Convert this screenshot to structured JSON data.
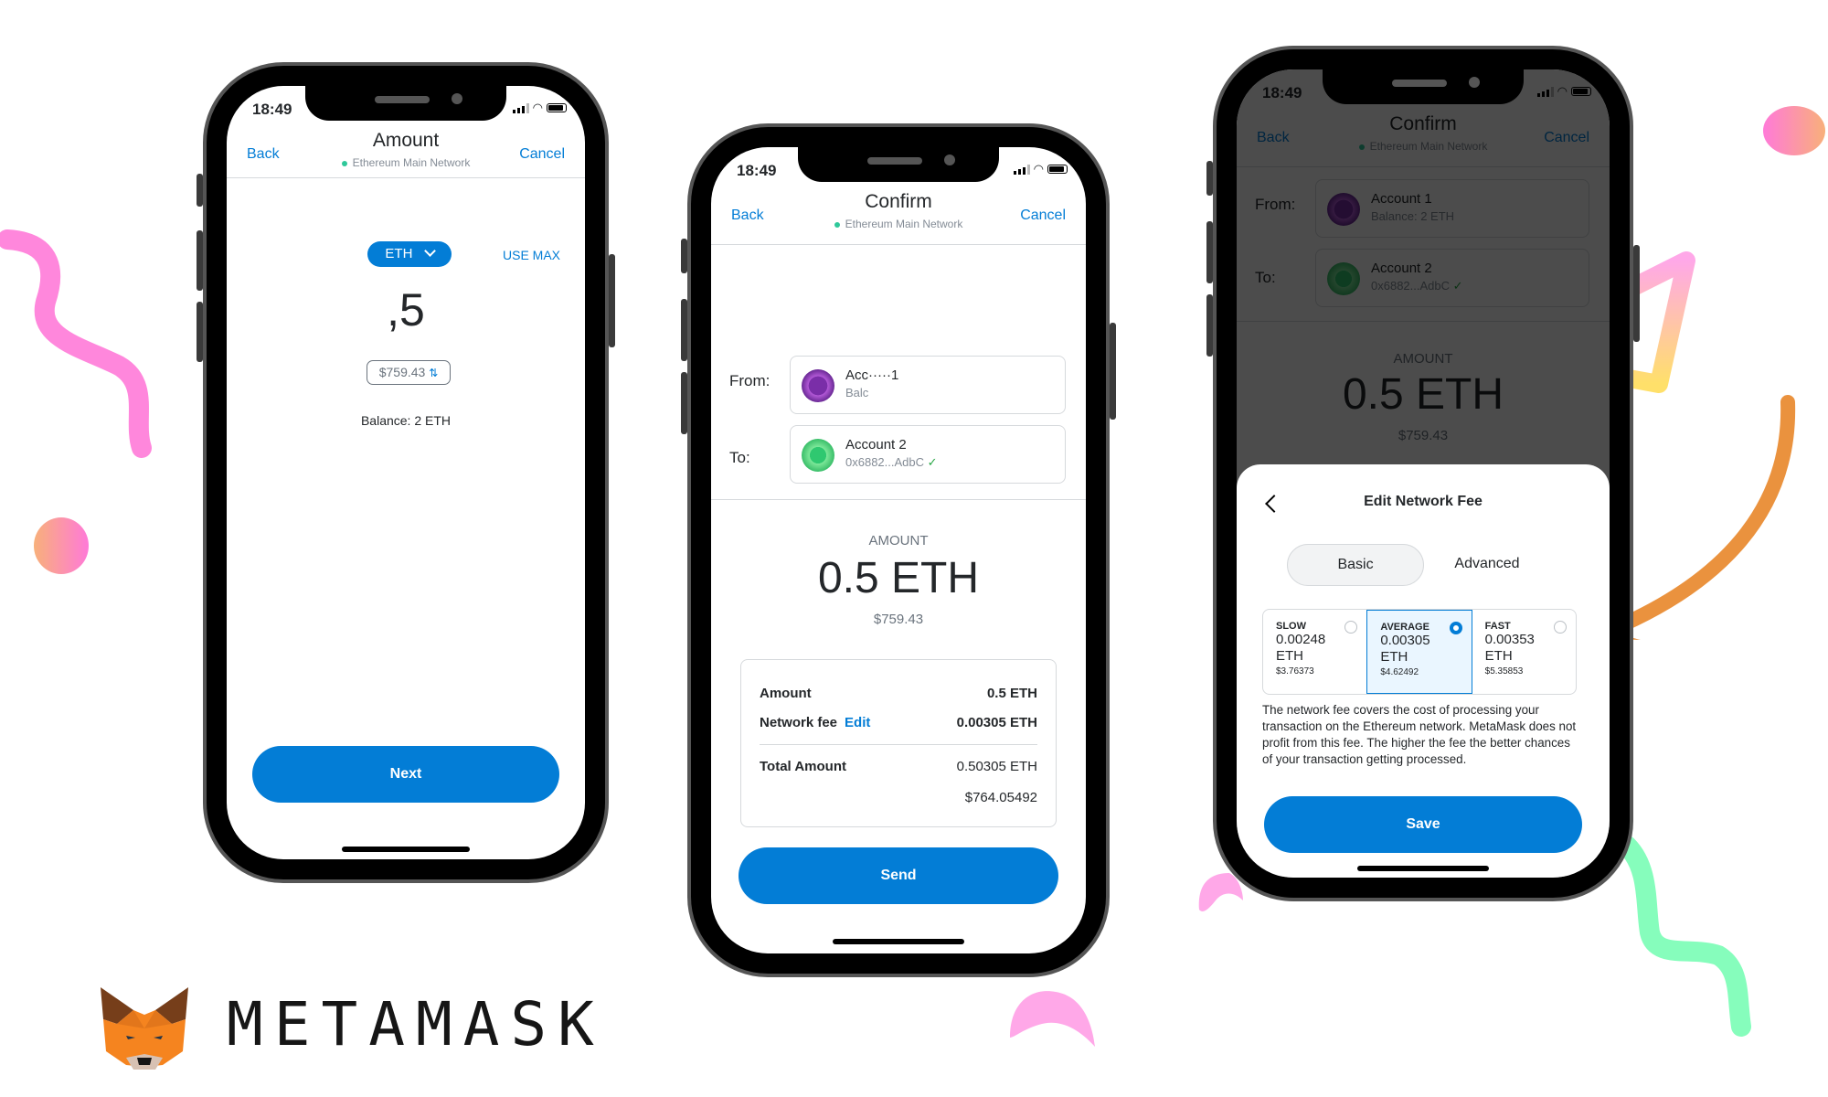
{
  "brand": {
    "wordmark": "METAMASK",
    "logo_icon": "metamask-fox-icon"
  },
  "colors": {
    "primary": "#037dd6",
    "network_dot": "#2fc89a",
    "arrow": "#ea923e",
    "selected_fee_bg": "#eaf6ff"
  },
  "status_bar": {
    "time": "18:49",
    "icons": [
      "signal-icon",
      "wifi-icon",
      "battery-icon"
    ]
  },
  "phone_amount": {
    "nav": {
      "back": "Back",
      "title": "Amount",
      "network": "Ethereum Main Network",
      "cancel": "Cancel"
    },
    "asset_selector": "ETH",
    "use_max": "USE MAX",
    "amount_input": ",5",
    "fiat_value": "$759.43",
    "balance": "Balance: 2 ETH",
    "next_button": "Next"
  },
  "phone_confirm": {
    "nav": {
      "back": "Back",
      "title": "Confirm",
      "network": "Ethereum Main Network",
      "cancel": "Cancel"
    },
    "from_label": "From:",
    "to_label": "To:",
    "from_account": {
      "name": "Acc·····1",
      "sub": "Balc"
    },
    "to_account": {
      "name": "Account 2",
      "address": "0x6882...AdbC"
    },
    "amount_heading": "AMOUNT",
    "amount_value": "0.5 ETH",
    "amount_fiat": "$759.43",
    "summary": {
      "amount_label": "Amount",
      "amount_value": "0.5 ETH",
      "fee_label": "Network fee",
      "fee_edit": "Edit",
      "fee_value": "0.00305 ETH",
      "total_label": "Total Amount",
      "total_eth": "0.50305 ETH",
      "total_fiat": "$764.05492"
    },
    "send_button": "Send"
  },
  "phone_fee": {
    "nav": {
      "back": "Back",
      "title": "Confirm",
      "network": "Ethereum Main Network",
      "cancel": "Cancel"
    },
    "from_label": "From:",
    "to_label": "To:",
    "from_account": {
      "name": "Account 1",
      "sub": "Balance: 2 ETH"
    },
    "to_account": {
      "name": "Account 2",
      "address": "0x6882...AdbC"
    },
    "amount_heading": "AMOUNT",
    "amount_value": "0.5 ETH",
    "amount_fiat": "$759.43",
    "sheet": {
      "title": "Edit Network Fee",
      "tabs": [
        "Basic",
        "Advanced"
      ],
      "active_tab": "Basic",
      "options": [
        {
          "label": "SLOW",
          "eth": "0.00248",
          "unit": "ETH",
          "usd": "$3.76373",
          "selected": false
        },
        {
          "label": "AVERAGE",
          "eth": "0.00305",
          "unit": "ETH",
          "usd": "$4.62492",
          "selected": true
        },
        {
          "label": "FAST",
          "eth": "0.00353",
          "unit": "ETH",
          "usd": "$5.35853",
          "selected": false
        }
      ],
      "description": "The network fee covers the cost of processing your transaction on the Ethereum network. MetaMask does not profit from this fee. The higher the fee the better chances of your transaction getting processed.",
      "save_button": "Save"
    }
  }
}
